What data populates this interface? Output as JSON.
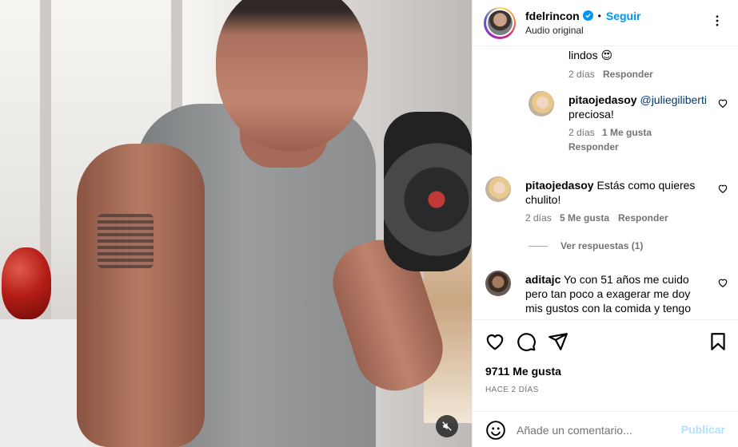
{
  "header": {
    "username": "fdelrincon",
    "separator": "•",
    "follow_label": "Seguir",
    "subtitle": "Audio original",
    "more_icon": "more-horizontal-icon"
  },
  "comments": {
    "partial_text": "lindos 😍",
    "partial_age": "2 días",
    "partial_reply": "Responder",
    "reply1": {
      "username": "pitaojedasoy",
      "mention": "@juliegiliberti",
      "text": "preciosa!",
      "age": "2 días",
      "likes": "1 Me gusta",
      "reply": "Responder"
    },
    "c2": {
      "username": "pitaojedasoy",
      "text_line1": "Estás como quieres",
      "text_line2": "chulito!",
      "age": "2 días",
      "likes": "5 Me gusta",
      "reply": "Responder",
      "view_replies": "Ver respuestas (1)"
    },
    "c3": {
      "username": "aditajc",
      "text_line1": "Yo con 51 años me cuido",
      "text_line2": "pero tan poco a exagerar me doy",
      "text_line3": "mis gustos con la comida y tengo"
    }
  },
  "footer": {
    "likes_count": "9711 Me gusta",
    "date": "HACE 2 DÍAS",
    "comment_placeholder": "Añade un comentario...",
    "publish_label": "Publicar"
  },
  "colors": {
    "accent": "#0095f6",
    "muted": "#737373",
    "publish_disabled": "#b2dffc"
  }
}
